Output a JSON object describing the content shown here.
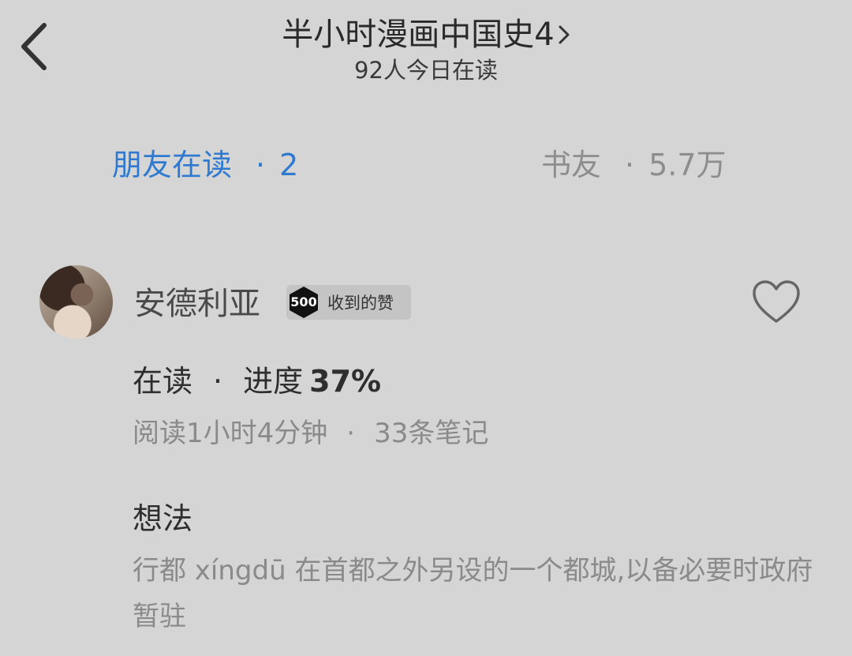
{
  "header": {
    "book_title": "半小时漫画中国史4",
    "readers_today": "92人今日在读"
  },
  "tabs": [
    {
      "label": "朋友在读",
      "separator": "·",
      "count": "2",
      "active": true
    },
    {
      "label": "书友",
      "separator": "·",
      "count": "5.7万",
      "active": false
    }
  ],
  "reader": {
    "name": "安德利亚",
    "likes_count": "500",
    "likes_label": "收到的赞",
    "status_label": "在读",
    "status_separator": "·",
    "progress_label": "进度",
    "progress_value": "37%",
    "progress_fraction": 0.37,
    "reading_time": "阅读1小时4分钟",
    "meta_separator": "·",
    "notes_count": "33条笔记",
    "thought_title": "想法",
    "thought_text": "行都 xíngdū 在首都之外另设的一个都城,以备必要时政府暂驻"
  },
  "colors": {
    "background": "#d5d5d5",
    "active_tab": "#2f7ad1",
    "inactive_text": "#8d8d8d"
  },
  "icons": [
    "back-chevron-icon",
    "title-chevron-right-icon",
    "heart-outline-icon",
    "hexagon-badge-icon"
  ]
}
